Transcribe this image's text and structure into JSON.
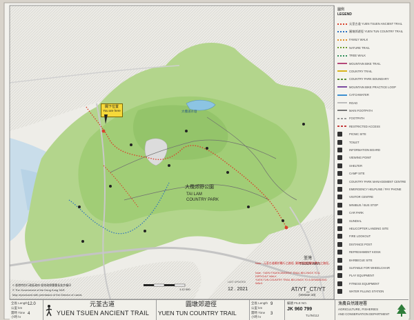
{
  "map": {
    "you_are_here_zh": "閣下位置",
    "you_are_here_en": "You are here",
    "park_name_zh": "大欖郊野公園",
    "park_name_en_1": "TAI LAM",
    "park_name_en_2": "COUNTRY PARK",
    "reservoir_zh": "大欖涌水塘",
    "tsuen_wan_zh": "荃灣",
    "tsuen_wan_en": "TSUEN WAN",
    "copyright_1": "© 香港特別行政區政府 經地政總署署長准許複印",
    "copyright_2": "© The Government of the Hong Kong SAR",
    "copyright_3": "Map reproduced with permission of the Director of Lands",
    "scale": "1:12 000"
  },
  "legend": {
    "title_zh": "圖例",
    "title_en": "LEGEND",
    "items": [
      {
        "label": "元荃古道 YUEN TSUEN ANCIENT TRAIL",
        "color": "#d9402b",
        "kind": "dots"
      },
      {
        "label": "圓墩郊遊徑 YUEN TUN COUNTRY TRAIL",
        "color": "#2a6fc0",
        "kind": "dots"
      },
      {
        "label": "FAMILY WALK",
        "color": "#e08a1f",
        "kind": "dots"
      },
      {
        "label": "NATURE TRAIL",
        "color": "#6a9b2e",
        "kind": "dots"
      },
      {
        "label": "TREE WALK",
        "color": "#2f8f5a",
        "kind": "dots"
      },
      {
        "label": "MOUNTAIN BIKE TRAIL",
        "color": "#b5487a",
        "kind": "line"
      },
      {
        "label": "COUNTRY TRAIL",
        "color": "#d8b21a",
        "kind": "line"
      },
      {
        "label": "COUNTRY PARK BOUNDARY",
        "color": "#5a8f3a",
        "kind": "dash"
      },
      {
        "label": "MOUNTAIN BIKE PRACTICE LOOP",
        "color": "#7a4aa0",
        "kind": "line"
      },
      {
        "label": "CATCHWATER",
        "color": "#3b8fd0",
        "kind": "line"
      },
      {
        "label": "ROAD",
        "color": "#bcbcbc",
        "kind": "line"
      },
      {
        "label": "MAIN FOOTPATH",
        "color": "#777777",
        "kind": "line"
      },
      {
        "label": "FOOTPATH",
        "color": "#999999",
        "kind": "dash"
      },
      {
        "label": "RESTRICTED ACCESS",
        "color": "#c43a3a",
        "kind": "dash"
      },
      {
        "label": "PICNIC SITE",
        "color": "#333333",
        "kind": "icon"
      },
      {
        "label": "TOILET",
        "color": "#333333",
        "kind": "icon"
      },
      {
        "label": "INFORMATION BOARD",
        "color": "#333333",
        "kind": "icon"
      },
      {
        "label": "VIEWING POINT",
        "color": "#333333",
        "kind": "icon"
      },
      {
        "label": "SHELTER",
        "color": "#333333",
        "kind": "icon"
      },
      {
        "label": "CAMP SITE",
        "color": "#333333",
        "kind": "icon"
      },
      {
        "label": "COUNTRY PARK MANAGEMENT CENTRE",
        "color": "#333333",
        "kind": "icon"
      },
      {
        "label": "EMERGENCY HELPLINE / PAY PHONE",
        "color": "#333333",
        "kind": "icon"
      },
      {
        "label": "VISITOR CENTRE",
        "color": "#333333",
        "kind": "icon"
      },
      {
        "label": "MINIBUS / BUS STOP",
        "color": "#333333",
        "kind": "icon"
      },
      {
        "label": "CAR PARK",
        "color": "#333333",
        "kind": "icon"
      },
      {
        "label": "SUNDIAL",
        "color": "#333333",
        "kind": "icon"
      },
      {
        "label": "HELICOPTER LANDING SITE",
        "color": "#333333",
        "kind": "icon"
      },
      {
        "label": "FIRE LOOKOUT",
        "color": "#333333",
        "kind": "icon"
      },
      {
        "label": "DISTANCE POST",
        "color": "#333333",
        "kind": "icon"
      },
      {
        "label": "REFRESHMENT KIOSK",
        "color": "#333333",
        "kind": "icon"
      },
      {
        "label": "BARBECUE SITE",
        "color": "#333333",
        "kind": "icon"
      },
      {
        "label": "SUITABLE FOR WHEELCHAIR",
        "color": "#333333",
        "kind": "icon"
      },
      {
        "label": "PLAY EQUIPMENT",
        "color": "#333333",
        "kind": "icon"
      },
      {
        "label": "FITNESS EQUIPMENT",
        "color": "#333333",
        "kind": "icon"
      },
      {
        "label": "WATER FILLING STATION",
        "color": "#333333",
        "kind": "icon"
      }
    ]
  },
  "notes": {
    "update_date": "12 . 2021",
    "last_updated": "LAST UPDATED",
    "code_main": "AT/YT_CT/YT",
    "version": "(Version 10)",
    "warning_zh": "Note : 元荃古道屬於難行之路徑, 圓墩郊遊徑屬於費力之路徑。",
    "warning_en_1": "Note : YUEN TSUEN ANCIENT TRAIL BELONGS TO A DIFFICULT WALK",
    "warning_en_2": "YUEN TUN COUNTRY TRAIL BELONGS TO A DEMANDING WALK"
  },
  "footer": {
    "trail1_zh": "元荃古道",
    "trail1_en": "YUEN TSUEN ANCIENT TRAIL",
    "trail1_length": "12.0",
    "trail1_time": "4",
    "trail2_zh": "圓墩郊遊徑",
    "trail2_en": "YUEN TUN COUNTRY TRAIL",
    "trail2_length": "9",
    "trail2_time": "3",
    "length_label": "全長 Length",
    "time_label": "需時 Time",
    "unit_km": "公里 km",
    "unit_hr": "小時 hr",
    "ref_label": "編號 FILE NO.",
    "ref_no": "JK 960 799",
    "ref_sub": "TL/IN/112",
    "dept_zh": "漁農自然護理署",
    "dept_en_1": "AGRICULTURE, FISHERIES",
    "dept_en_2": "AND CONSERVATION DEPARTMENT"
  }
}
